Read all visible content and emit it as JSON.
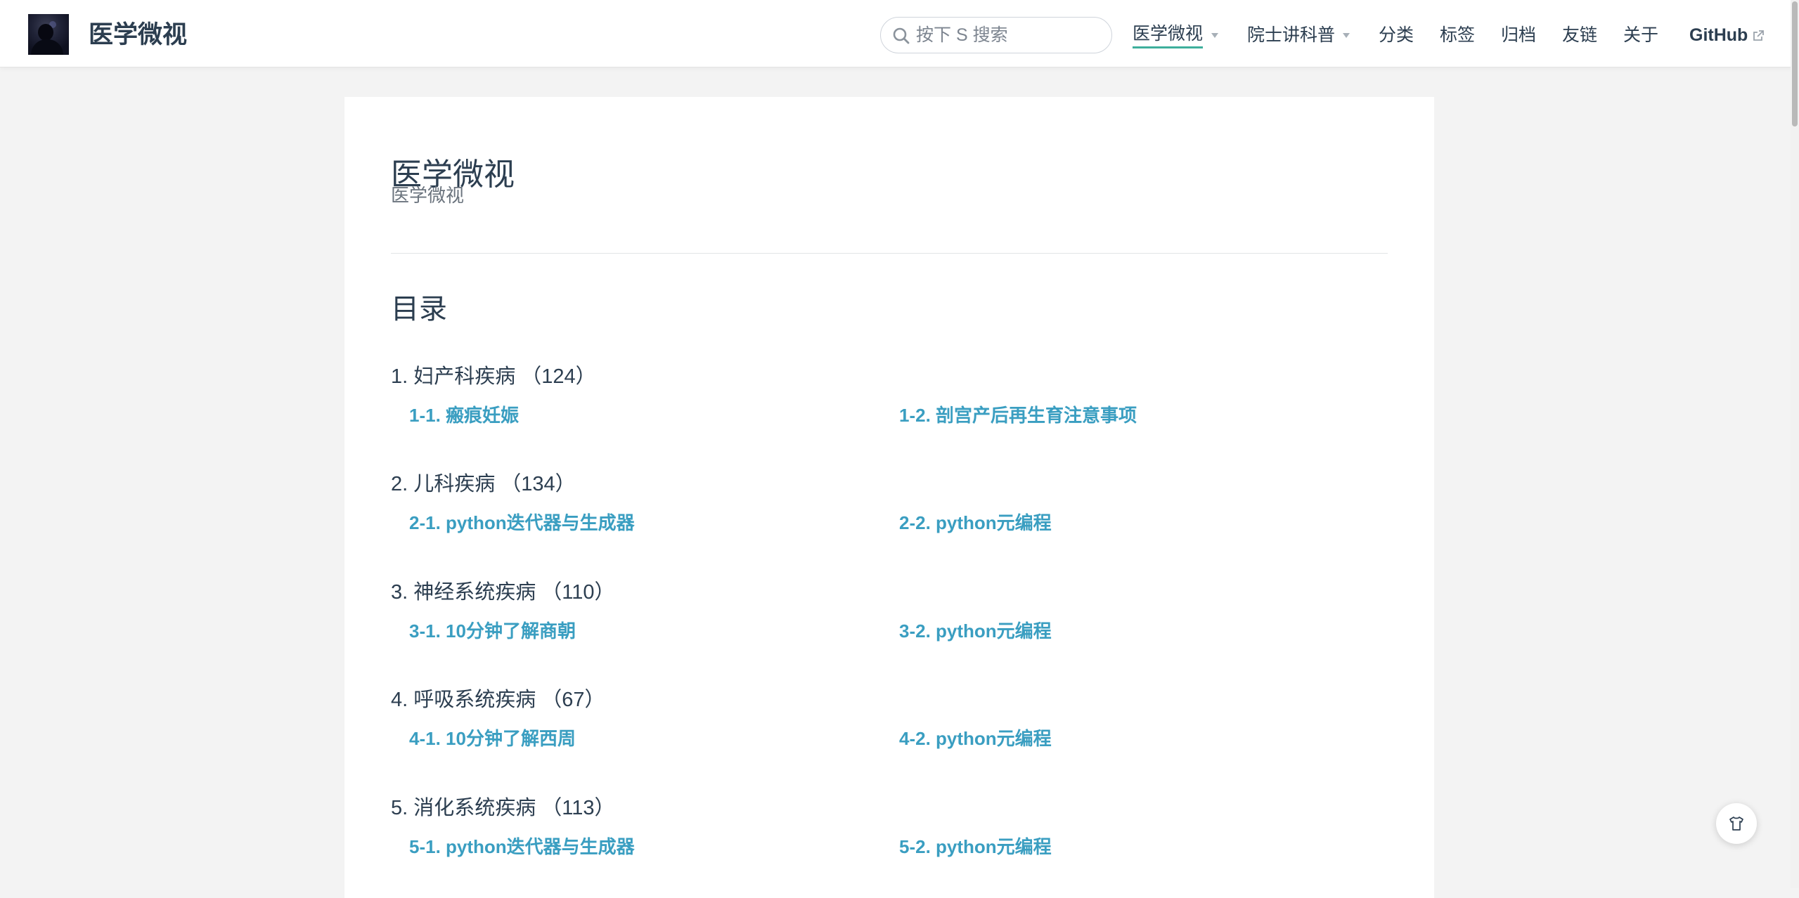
{
  "navbar": {
    "site_name": "医学微视",
    "search_placeholder": "按下 S 搜索",
    "items": [
      {
        "label": "医学微视",
        "active": true,
        "dropdown": true
      },
      {
        "label": "院士讲科普",
        "active": false,
        "dropdown": true
      },
      {
        "label": "分类"
      },
      {
        "label": "标签"
      },
      {
        "label": "归档"
      },
      {
        "label": "友链"
      },
      {
        "label": "关于"
      },
      {
        "label": "GitHub",
        "external": true
      }
    ],
    "active_underline_color": "#3eaf9c"
  },
  "page": {
    "title": "医学微视",
    "subtitle": "医学微视",
    "toc_title": "目录",
    "link_color": "#3a9ec1",
    "sections": [
      {
        "heading": "1. 妇产科疾病 （124）",
        "links": [
          "1-1. 瘢痕妊娠",
          "1-2. 剖宫产后再生育注意事项"
        ]
      },
      {
        "heading": "2. 儿科疾病 （134）",
        "links": [
          "2-1. python迭代器与生成器",
          "2-2. python元编程"
        ]
      },
      {
        "heading": "3. 神经系统疾病 （110）",
        "links": [
          "3-1. 10分钟了解商朝",
          "3-2. python元编程"
        ]
      },
      {
        "heading": "4. 呼吸系统疾病 （67）",
        "links": [
          "4-1. 10分钟了解西周",
          "4-2. python元编程"
        ]
      },
      {
        "heading": "5. 消化系统疾病 （113）",
        "links": [
          "5-1. python迭代器与生成器",
          "5-2. python元编程"
        ]
      }
    ]
  },
  "icons": {
    "search": "search-icon",
    "external_link": "external-link-icon",
    "theme_toggle": "tshirt-icon",
    "dropdown": "caret-down-icon"
  }
}
